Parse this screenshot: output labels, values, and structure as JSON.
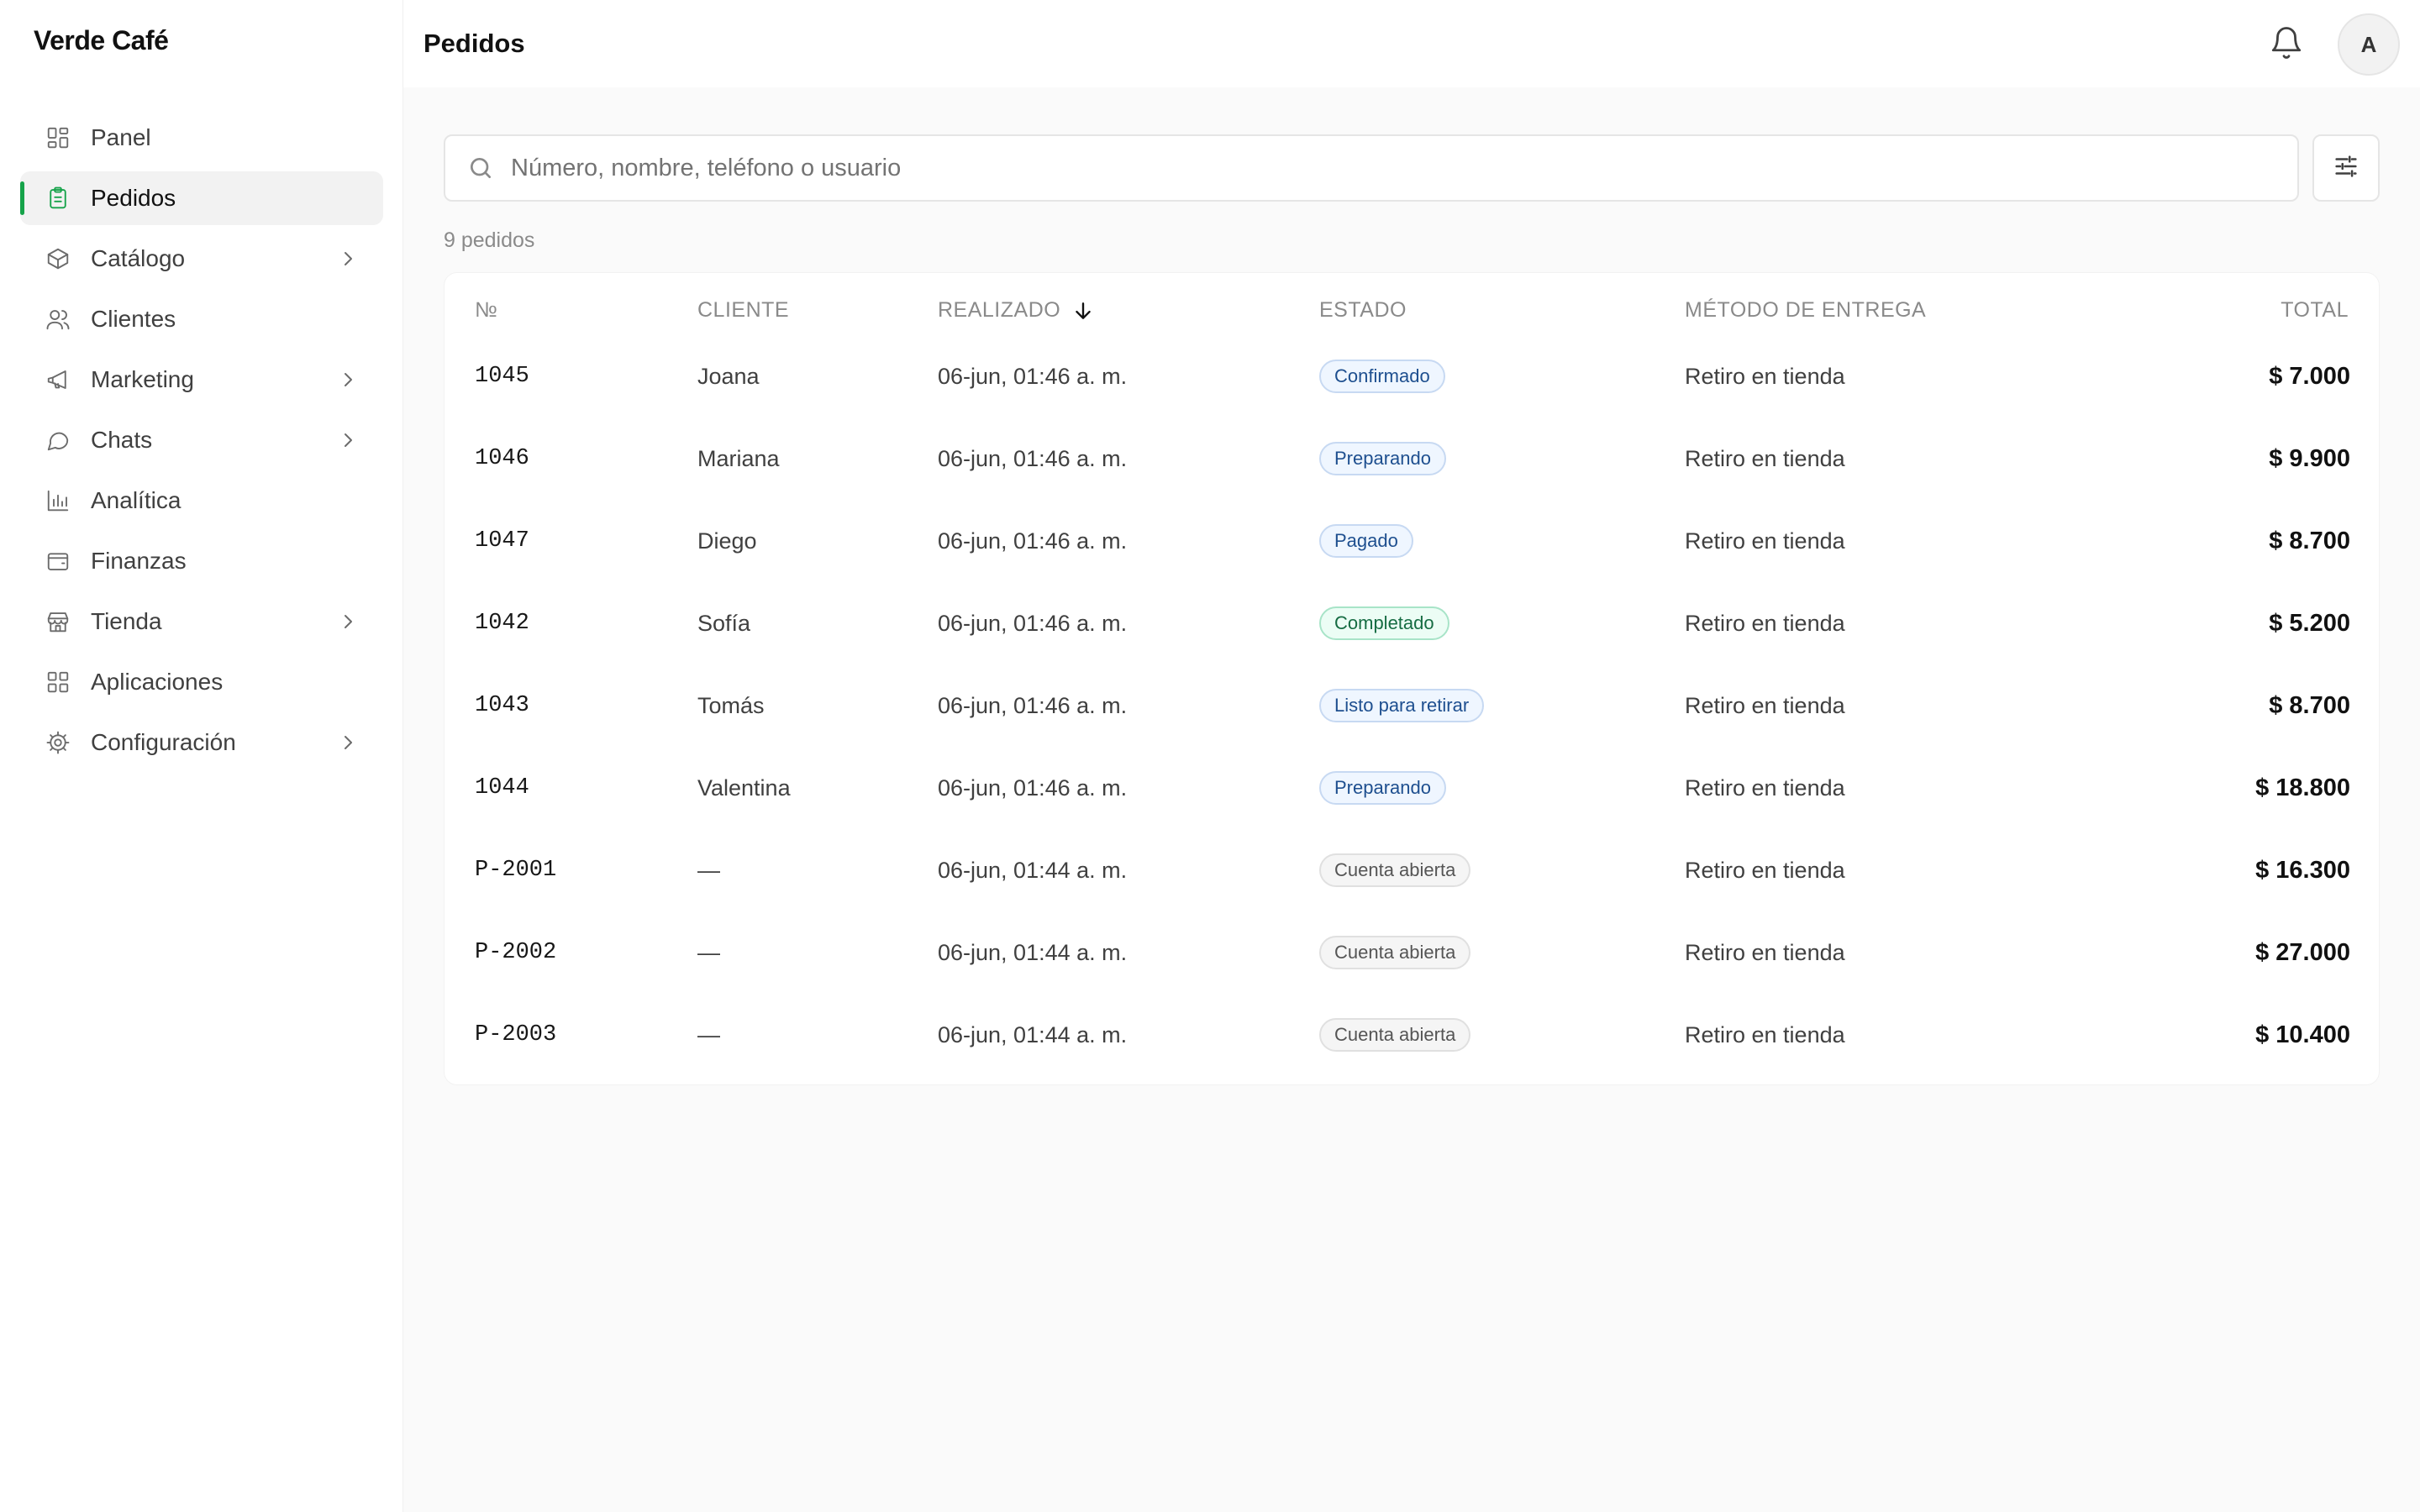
{
  "app": {
    "brand": "Verde Café"
  },
  "sidebar": {
    "items": [
      {
        "label": "Panel",
        "icon": "grid-icon",
        "chevron": false,
        "active": false
      },
      {
        "label": "Pedidos",
        "icon": "clipboard-icon",
        "chevron": false,
        "active": true
      },
      {
        "label": "Catálogo",
        "icon": "box-icon",
        "chevron": true,
        "active": false
      },
      {
        "label": "Clientes",
        "icon": "users-icon",
        "chevron": false,
        "active": false
      },
      {
        "label": "Marketing",
        "icon": "megaphone-icon",
        "chevron": true,
        "active": false
      },
      {
        "label": "Chats",
        "icon": "chat-bubble-icon",
        "chevron": true,
        "active": false
      },
      {
        "label": "Analítica",
        "icon": "bar-chart-icon",
        "chevron": false,
        "active": false
      },
      {
        "label": "Finanzas",
        "icon": "wallet-icon",
        "chevron": false,
        "active": false
      },
      {
        "label": "Tienda",
        "icon": "store-icon",
        "chevron": true,
        "active": false
      },
      {
        "label": "Aplicaciones",
        "icon": "apps-grid-icon",
        "chevron": false,
        "active": false
      },
      {
        "label": "Configuración",
        "icon": "gear-icon",
        "chevron": true,
        "active": false
      }
    ]
  },
  "header": {
    "title": "Pedidos",
    "avatar_initial": "A"
  },
  "search": {
    "placeholder": "Número, nombre, teléfono o usuario",
    "value": ""
  },
  "orders": {
    "count_label": "9 pedidos",
    "columns": {
      "number": "№",
      "client": "CLIENTE",
      "placed": "REALIZADO",
      "status": "ESTADO",
      "delivery": "MÉTODO DE ENTREGA",
      "total": "TOTAL"
    },
    "sort": {
      "column": "placed",
      "direction": "desc"
    },
    "rows": [
      {
        "number": "1045",
        "client": "Joana",
        "placed": "06-jun, 01:46 a. m.",
        "status": "Confirmado",
        "status_tone": "blue",
        "delivery": "Retiro en tienda",
        "total": "$ 7.000"
      },
      {
        "number": "1046",
        "client": "Mariana",
        "placed": "06-jun, 01:46 a. m.",
        "status": "Preparando",
        "status_tone": "blue",
        "delivery": "Retiro en tienda",
        "total": "$ 9.900"
      },
      {
        "number": "1047",
        "client": "Diego",
        "placed": "06-jun, 01:46 a. m.",
        "status": "Pagado",
        "status_tone": "blue",
        "delivery": "Retiro en tienda",
        "total": "$ 8.700"
      },
      {
        "number": "1042",
        "client": "Sofía",
        "placed": "06-jun, 01:46 a. m.",
        "status": "Completado",
        "status_tone": "green",
        "delivery": "Retiro en tienda",
        "total": "$ 5.200"
      },
      {
        "number": "1043",
        "client": "Tomás",
        "placed": "06-jun, 01:46 a. m.",
        "status": "Listo para retirar",
        "status_tone": "blue",
        "delivery": "Retiro en tienda",
        "total": "$ 8.700"
      },
      {
        "number": "1044",
        "client": "Valentina",
        "placed": "06-jun, 01:46 a. m.",
        "status": "Preparando",
        "status_tone": "blue",
        "delivery": "Retiro en tienda",
        "total": "$ 18.800"
      },
      {
        "number": "P-2001",
        "client": "—",
        "placed": "06-jun, 01:44 a. m.",
        "status": "Cuenta abierta",
        "status_tone": "gray",
        "delivery": "Retiro en tienda",
        "total": "$ 16.300"
      },
      {
        "number": "P-2002",
        "client": "—",
        "placed": "06-jun, 01:44 a. m.",
        "status": "Cuenta abierta",
        "status_tone": "gray",
        "delivery": "Retiro en tienda",
        "total": "$ 27.000"
      },
      {
        "number": "P-2003",
        "client": "—",
        "placed": "06-jun, 01:44 a. m.",
        "status": "Cuenta abierta",
        "status_tone": "gray",
        "delivery": "Retiro en tienda",
        "total": "$ 10.400"
      }
    ]
  },
  "colors": {
    "accent": "#16a34a",
    "status_blue": "#1e4f8f",
    "status_green": "#166c43",
    "status_gray": "#555555"
  }
}
